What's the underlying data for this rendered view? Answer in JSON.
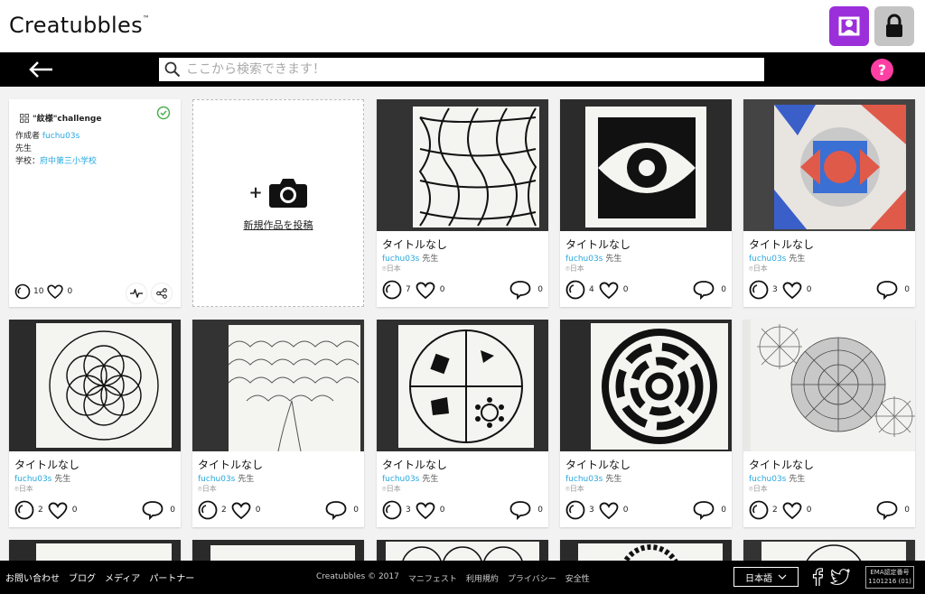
{
  "header": {
    "logo": "Creatubbles",
    "logo_tm": "™"
  },
  "search": {
    "placeholder": "ここから検索できます！"
  },
  "help_label": "?",
  "info_card": {
    "title": "\"紋様\"challenge",
    "creator_label": "作成者",
    "creator": "fuchu03s",
    "role": "先生",
    "school_label": "学校：",
    "school": "府中第三小学校",
    "views": "10",
    "likes": "0"
  },
  "upload": {
    "label": "新規作品を投稿"
  },
  "cards": [
    {
      "title": "タイトルなし",
      "author": "fuchu03s",
      "role": "先生",
      "location": "日本",
      "views": "7",
      "likes": "0",
      "comments": "0"
    },
    {
      "title": "タイトルなし",
      "author": "fuchu03s",
      "role": "先生",
      "location": "日本",
      "views": "4",
      "likes": "0",
      "comments": "0"
    },
    {
      "title": "タイトルなし",
      "author": "fuchu03s",
      "role": "先生",
      "location": "日本",
      "views": "3",
      "likes": "0",
      "comments": "0"
    },
    {
      "title": "タイトルなし",
      "author": "fuchu03s",
      "role": "先生",
      "location": "日本",
      "views": "2",
      "likes": "0",
      "comments": "0"
    },
    {
      "title": "タイトルなし",
      "author": "fuchu03s",
      "role": "先生",
      "location": "日本",
      "views": "2",
      "likes": "0",
      "comments": "0"
    },
    {
      "title": "タイトルなし",
      "author": "fuchu03s",
      "role": "先生",
      "location": "日本",
      "views": "3",
      "likes": "0",
      "comments": "0"
    },
    {
      "title": "タイトルなし",
      "author": "fuchu03s",
      "role": "先生",
      "location": "日本",
      "views": "3",
      "likes": "0",
      "comments": "0"
    },
    {
      "title": "タイトルなし",
      "author": "fuchu03s",
      "role": "先生",
      "location": "日本",
      "views": "2",
      "likes": "0",
      "comments": "0"
    }
  ],
  "footer": {
    "links": [
      "お問い合わせ",
      "ブログ",
      "メディア",
      "パートナー"
    ],
    "copyright": "Creatubbles © 2017",
    "mid_links": [
      "マニフェスト",
      "利用規約",
      "プライバシー",
      "安全性"
    ],
    "language": "日本語",
    "ema_line1": "EMA認定番号",
    "ema_line2": "1101216 (01)"
  },
  "colors": {
    "profile_button": "#9b2fd9",
    "lock_button": "#c4c4c4",
    "help_button": "#ff3fa4",
    "link": "#29a8e0",
    "check": "#4caf50"
  }
}
